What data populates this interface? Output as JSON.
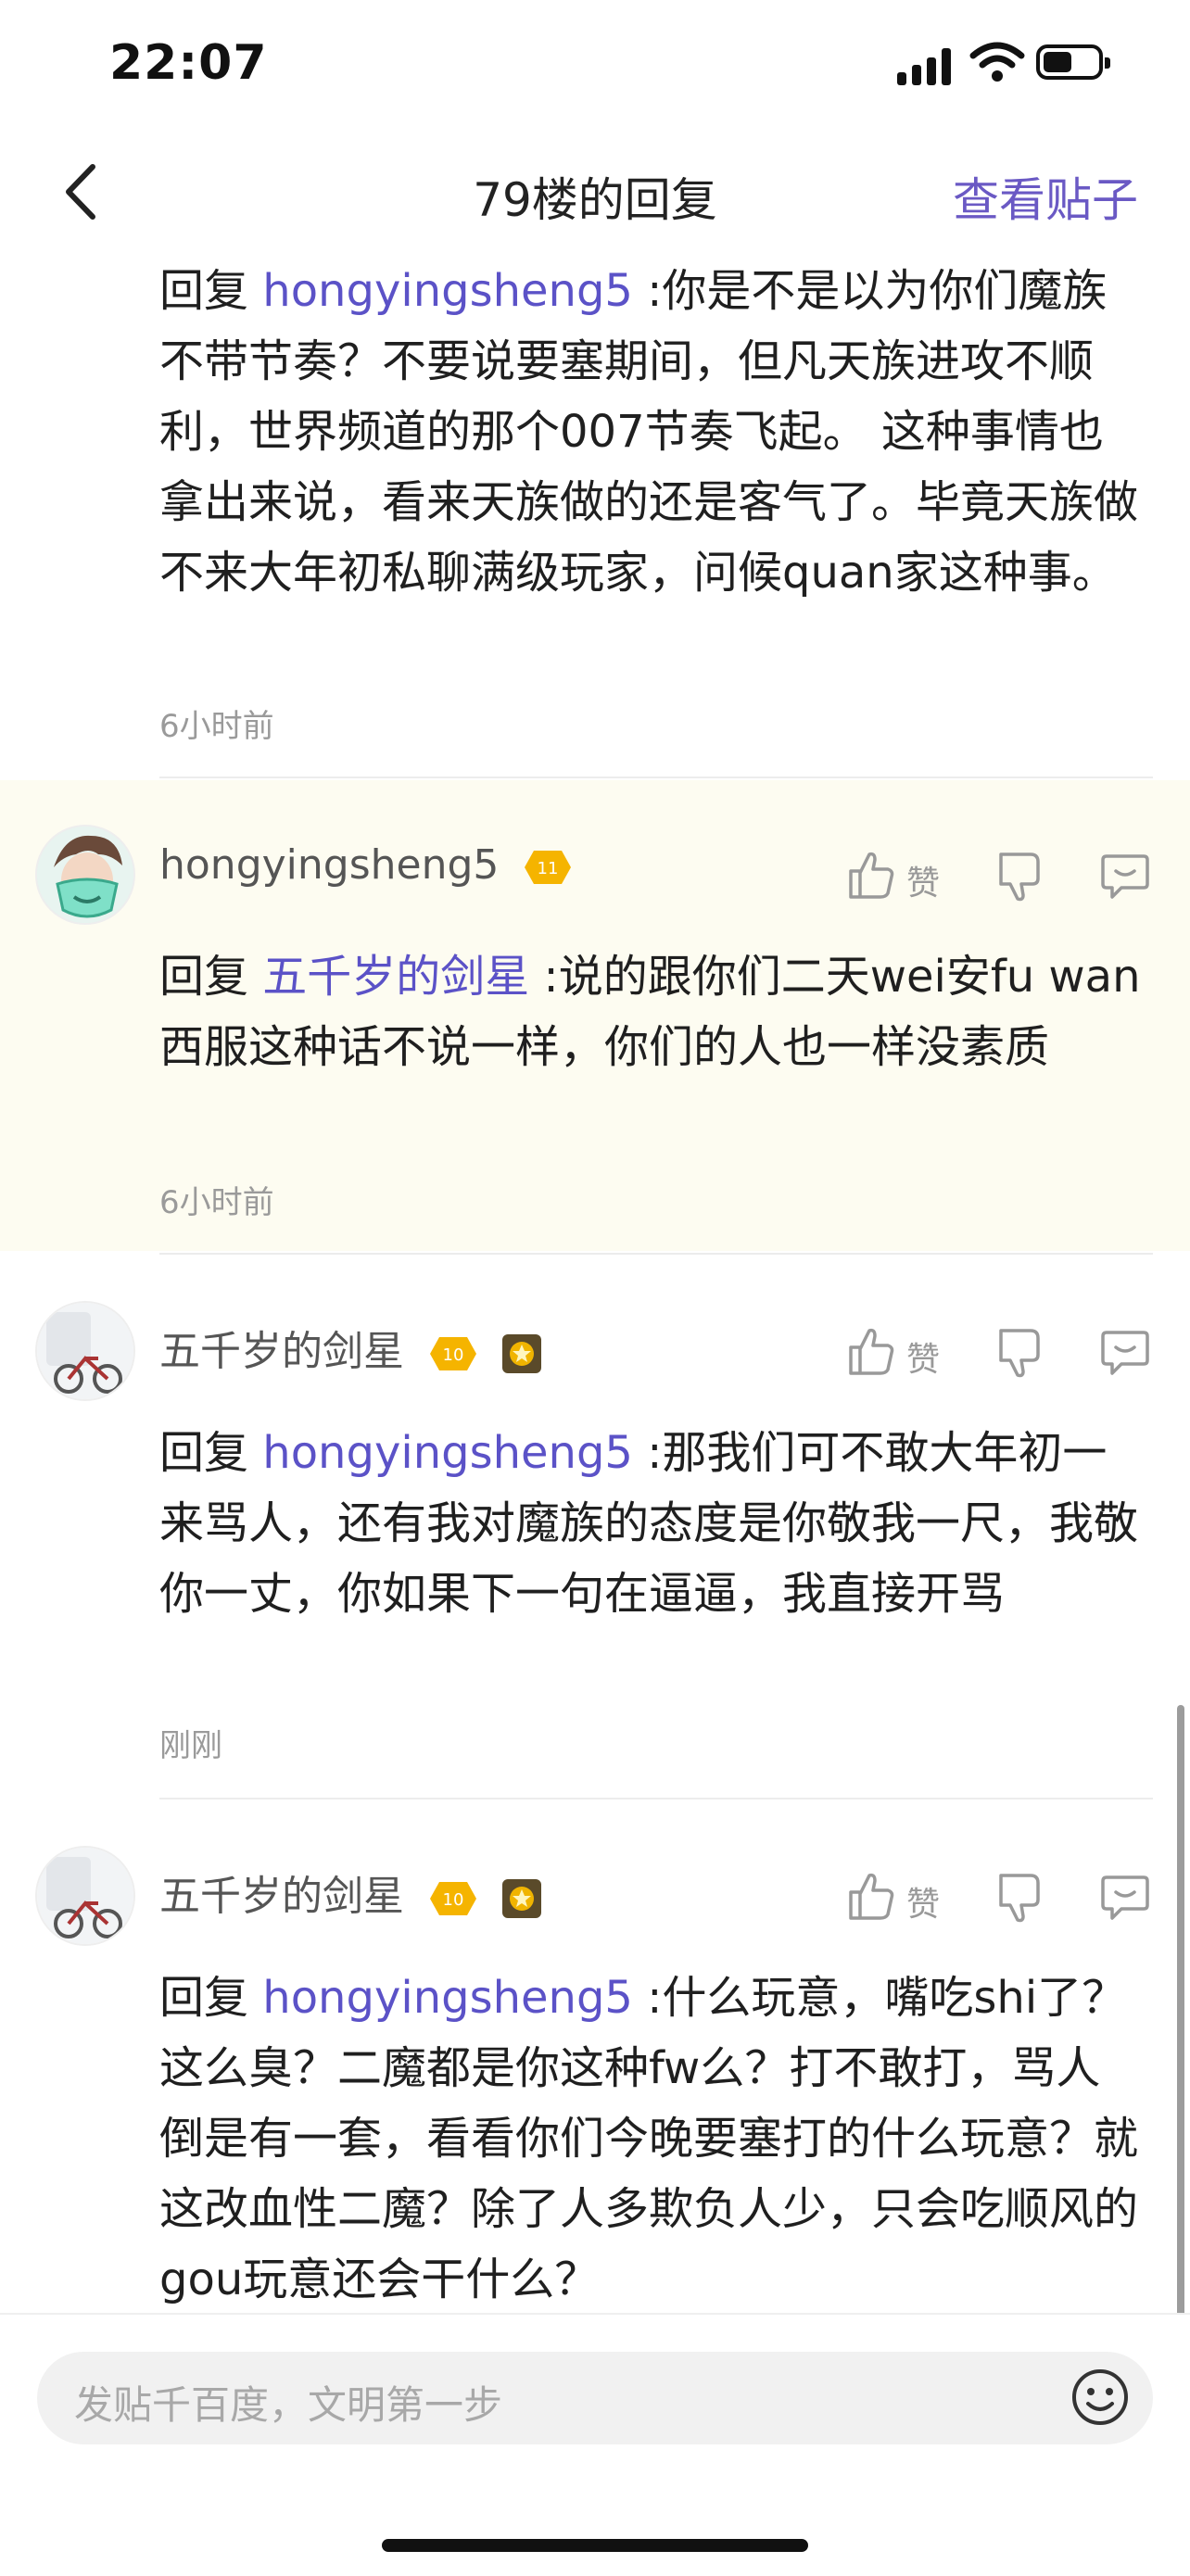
{
  "status_bar": {
    "time": "22:07"
  },
  "nav": {
    "title": "79楼的回复",
    "action_label": "查看贴子"
  },
  "top_reply": {
    "prefix": "回复 ",
    "mention": "hongyingsheng5",
    "text": " :你是不是以为你们魔族不带节奏？不要说要塞期间，但凡天族进攻不顺利，世界频道的那个007节奏飞起。 这种事情也拿出来说，看来天族做的还是客气了。毕竟天族做不来大年初私聊满级玩家，问候quan家这种事。",
    "time": "6小时前"
  },
  "comments": [
    {
      "username": "hongyingsheng5",
      "level": "11",
      "reply_prefix": "回复 ",
      "mention": "五千岁的剑星",
      "text": " :说的跟你们二天wei安fu wan西服这种话不说一样，你们的人也一样没素质",
      "time": "6小时前",
      "like_label": "赞"
    },
    {
      "username": "五千岁的剑星",
      "level": "10",
      "reply_prefix": "回复 ",
      "mention": "hongyingsheng5",
      "text": " :那我们可不敢大年初一来骂人，还有我对魔族的态度是你敬我一尺，我敬你一丈，你如果下一句在逼逼，我直接开骂",
      "time": "刚刚",
      "like_label": "赞"
    },
    {
      "username": "五千岁的剑星",
      "level": "10",
      "reply_prefix": "回复 ",
      "mention": "hongyingsheng5",
      "text": " :什么玩意，嘴吃shi了？这么臭？二魔都是你这种fw么？打不敢打，骂人倒是有一套，看看你们今晚要塞打的什么玩意？就这改血性二魔？除了人多欺负人少，只会吃顺风的gou玩意还会干什么？",
      "time": "",
      "like_label": "赞"
    }
  ],
  "input": {
    "placeholder": "发贴千百度，文明第一步"
  },
  "colors": {
    "accent": "#5b52c7",
    "highlight_bg": "#fdfcf1",
    "level_badge": "#f5b400"
  },
  "icons": [
    "back-chevron-icon",
    "thumbs-up-icon",
    "thumbs-down-icon",
    "reply-bubble-icon",
    "smiley-icon",
    "signal-icon",
    "wifi-icon",
    "battery-icon"
  ]
}
